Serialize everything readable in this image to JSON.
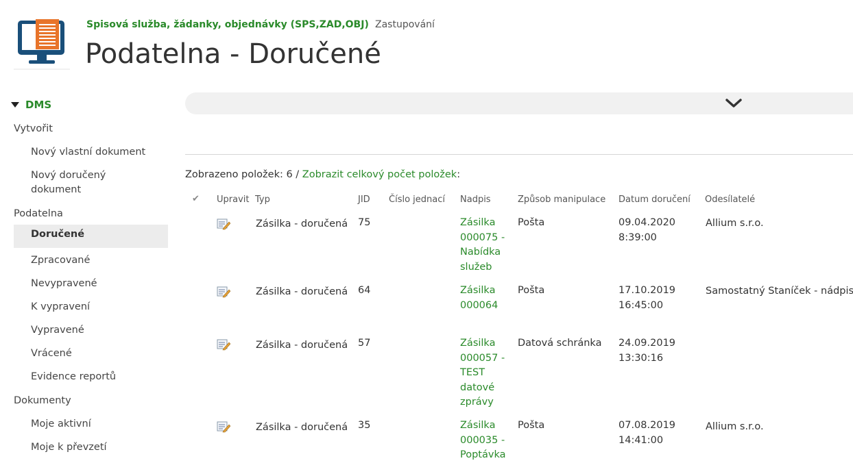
{
  "header": {
    "site_link": "Spisová služba, žádanky, objednávky (SPS,ZAD,OBJ)",
    "zastupovani": "Zastupování",
    "title": "Podatelna - Doručené",
    "logo_icon": "monitor-document-icon"
  },
  "nav": {
    "heading": "DMS",
    "sections": [
      {
        "label": "Vytvořit",
        "items": [
          "Nový vlastní dokument",
          "Nový doručený dokument"
        ]
      },
      {
        "label": "Podatelna",
        "items": [
          "Doručené",
          "Zpracované",
          "Nevypravené",
          "K vypravení",
          "Vypravené",
          "Vrácené",
          "Evidence reportů"
        ]
      },
      {
        "label": "Dokumenty",
        "items": [
          "Moje aktivní",
          "Moje k převzetí"
        ]
      }
    ],
    "selected": "Doručené"
  },
  "list": {
    "count_prefix": "Zobrazeno položek: 6 / ",
    "count_link": "Zobrazit celkový počet položek",
    "count_suffix": ":",
    "columns": {
      "check": "✔",
      "edit": "Upravit",
      "type": "Typ",
      "jid": "JID",
      "cislo": "Číslo jednací",
      "title": "Nadpis",
      "method": "Způsob manipulace",
      "date": "Datum doručení",
      "senders": "Odesílatelé"
    },
    "rows": [
      {
        "type": "Zásilka - doručená",
        "jid": "75",
        "cislo": "",
        "title": "Zásilka 000075 - Nabídka služeb",
        "method": "Pošta",
        "date": "09.04.2020 8:39:00",
        "sender": "Allium s.r.o."
      },
      {
        "type": "Zásilka - doručená",
        "jid": "64",
        "cislo": "",
        "title": "Zásilka 000064",
        "method": "Pošta",
        "date": "17.10.2019 16:45:00",
        "sender": "Samostatný Staníček - nádpis"
      },
      {
        "type": "Zásilka - doručená",
        "jid": "57",
        "cislo": "",
        "title": "Zásilka 000057 - TEST datové zprávy",
        "method": "Datová schránka",
        "date": "24.09.2019 13:30:16",
        "sender": ""
      },
      {
        "type": "Zásilka - doručená",
        "jid": "35",
        "cislo": "",
        "title": "Zásilka 000035 - Poptávka",
        "method": "Pošta",
        "date": "07.08.2019 14:41:00",
        "sender": "Allium s.r.o."
      }
    ]
  },
  "colors": {
    "accent": "#2a8a2a",
    "logo_blue": "#1a4f7a",
    "logo_orange": "#e8742a"
  }
}
